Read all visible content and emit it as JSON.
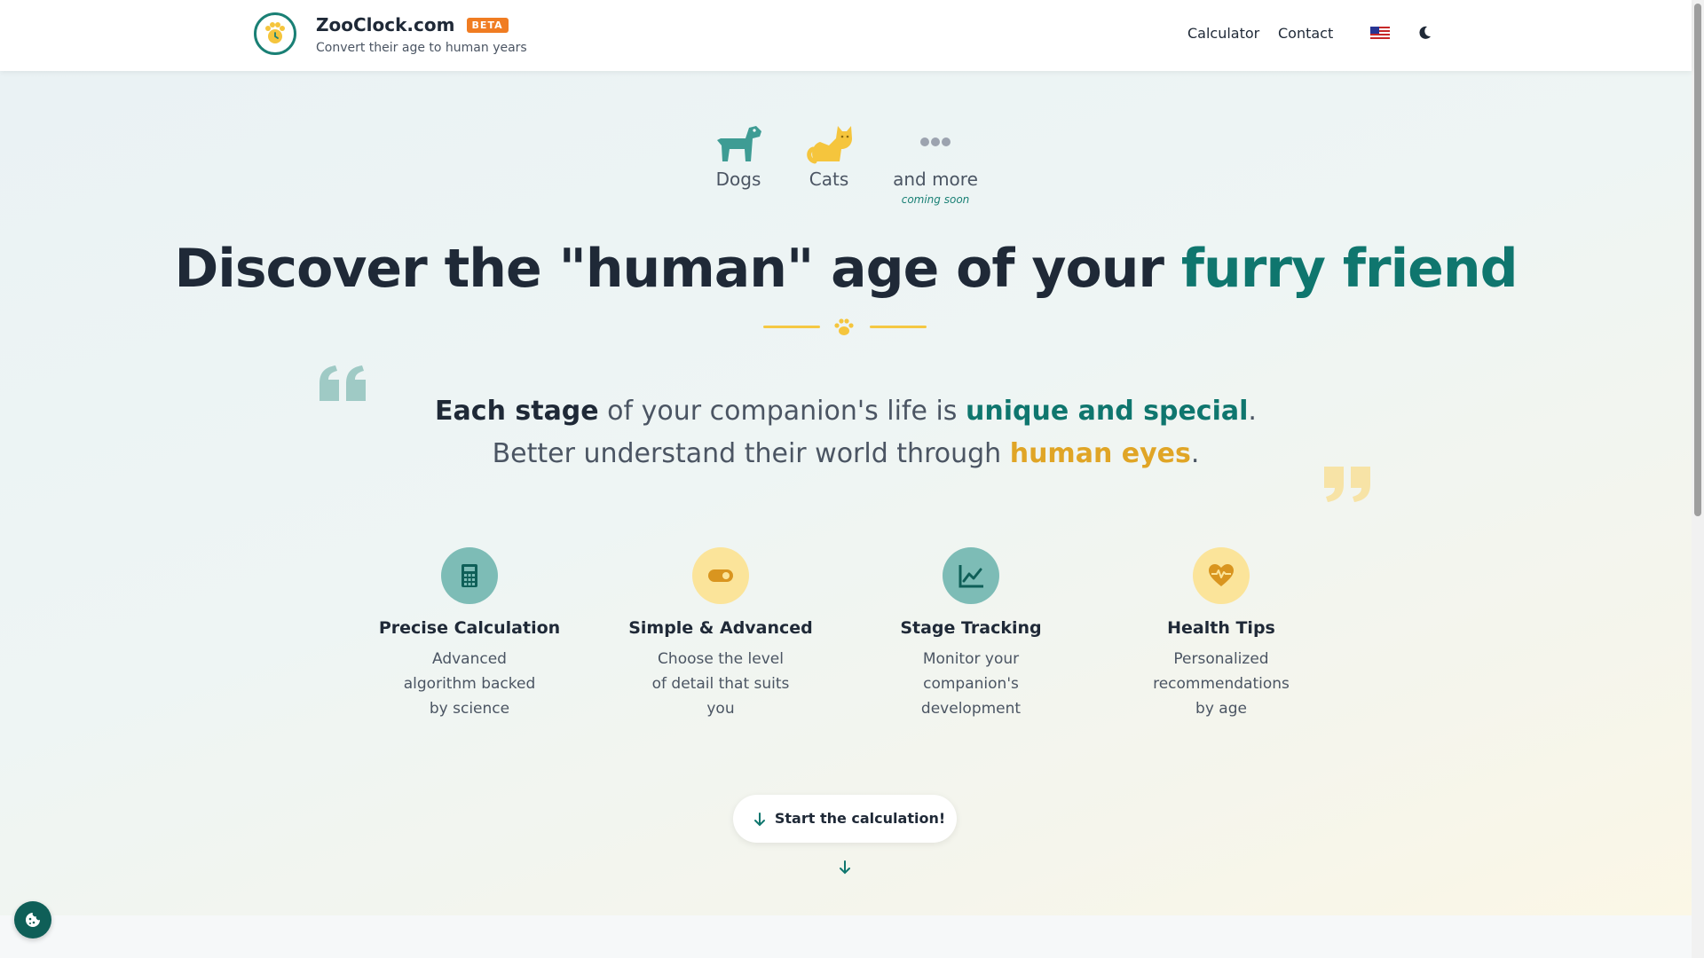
{
  "header": {
    "brand_title": "ZooClock.com",
    "beta_badge": "BETA",
    "subtitle": "Convert their age to human years",
    "nav": {
      "calculator": "Calculator",
      "contact": "Contact"
    },
    "icons": {
      "logo": "paw-clock-icon",
      "language": "us-flag-icon",
      "theme": "moon-icon"
    }
  },
  "animals": [
    {
      "label": "Dogs",
      "icon": "dog-icon",
      "color": "#3e9c94"
    },
    {
      "label": "Cats",
      "icon": "cat-icon",
      "color": "#f5c53d"
    },
    {
      "label": "and more",
      "icon": "dots-icon",
      "note": "coming soon",
      "color": "#9ca3af"
    }
  ],
  "headline": {
    "main": "Discover the \"human\" age of your ",
    "accent": "furry friend"
  },
  "quote": {
    "line1": {
      "strong": "Each stage",
      "mid": " of your companion's life is ",
      "accent": "unique and special",
      "end": "."
    },
    "line2": {
      "start": "Better understand their world through ",
      "accent": "human eyes",
      "end": "."
    }
  },
  "features": [
    {
      "title": "Precise Calculation",
      "desc": "Advanced algorithm backed by science",
      "icon": "calculator-icon",
      "bg": "#7dbcb6"
    },
    {
      "title": "Simple & Advanced",
      "desc": "Choose the level of detail that suits you",
      "icon": "toggle-icon",
      "bg": "#fbe49a"
    },
    {
      "title": "Stage Tracking",
      "desc": "Monitor your companion's development",
      "icon": "chart-line-icon",
      "bg": "#7dbcb6"
    },
    {
      "title": "Health Tips",
      "desc": "Personalized recommendations by age",
      "icon": "heart-pulse-icon",
      "bg": "#fbe49a"
    }
  ],
  "cta": {
    "label": "Start the calculation!"
  },
  "colors": {
    "teal": "#0f766e",
    "gold": "#e0a526",
    "beta": "#f07c22"
  }
}
